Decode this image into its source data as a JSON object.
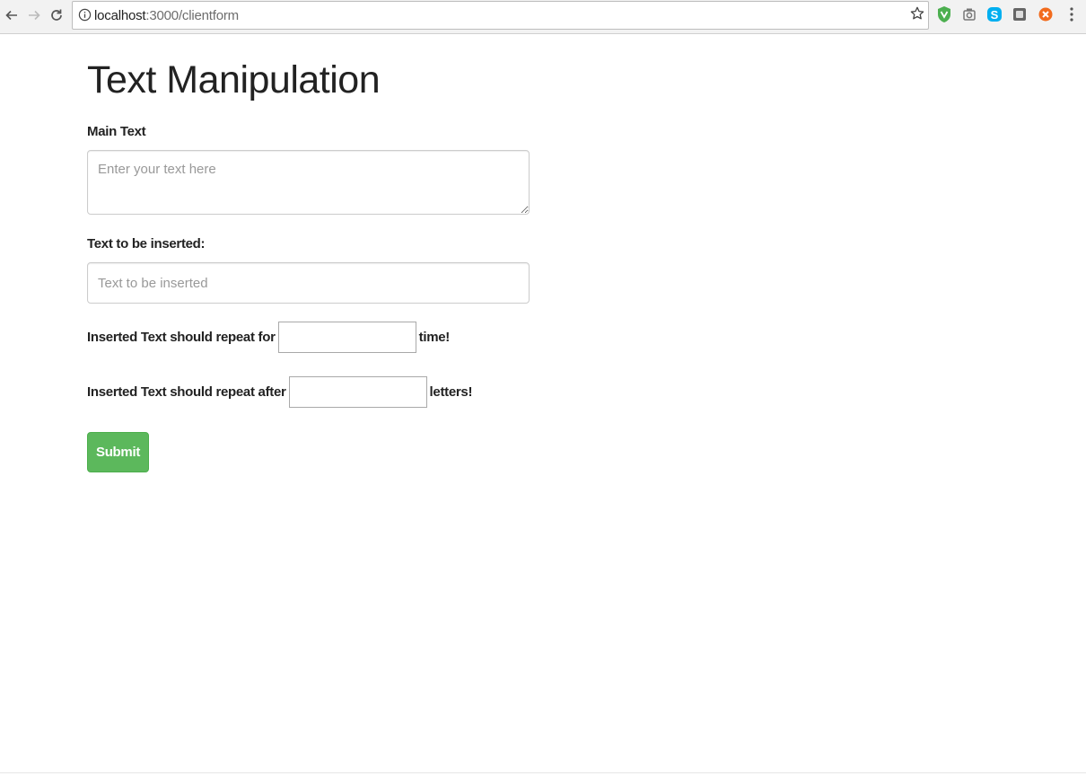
{
  "browser": {
    "url_host": "localhost",
    "url_path": ":3000/clientform",
    "extension_icons": [
      "shield-extension-icon",
      "camera-extension-icon",
      "skype-extension-icon",
      "square-extension-icon",
      "close-circle-extension-icon"
    ],
    "colors": {
      "shield": "#4caf50",
      "skype": "#00aff0",
      "orange": "#f26b1d"
    }
  },
  "page": {
    "title": "Text Manipulation",
    "main_text": {
      "label": "Main Text",
      "placeholder": "Enter your text here",
      "value": ""
    },
    "insert_text": {
      "label": "Text to be inserted:",
      "placeholder": "Text to be inserted",
      "value": ""
    },
    "repeat_times": {
      "prefix": "Inserted Text should repeat for",
      "suffix": "time!",
      "value": ""
    },
    "repeat_after": {
      "prefix": "Inserted Text should repeat after",
      "suffix": "letters!",
      "value": ""
    },
    "submit_label": "Submit",
    "colors": {
      "submit_bg": "#5cb85c",
      "text": "#222222"
    }
  }
}
